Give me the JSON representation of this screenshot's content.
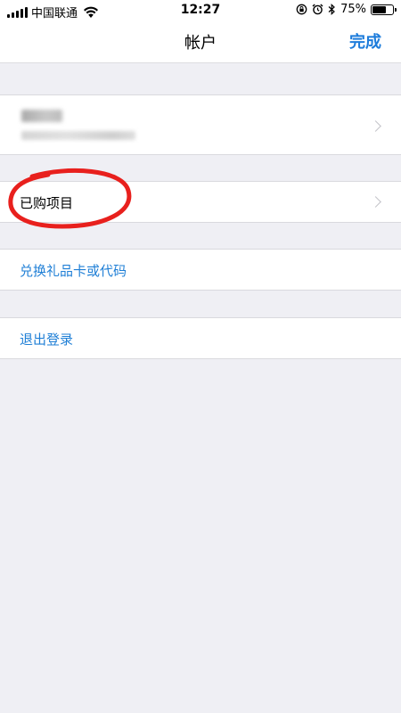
{
  "status_bar": {
    "carrier": "中国联通",
    "time": "12:27",
    "battery_text": "75%",
    "battery_level": 0.75,
    "icons": [
      "signal-icon",
      "wifi-icon",
      "orientation-lock-icon",
      "alarm-icon",
      "bluetooth-icon",
      "battery-icon"
    ]
  },
  "nav": {
    "title": "帐户",
    "done_label": "完成"
  },
  "account": {
    "name": "",
    "email": "",
    "blurred": true
  },
  "purchased": {
    "label": "已购项目",
    "annotation_color": "#e8201d"
  },
  "redeem": {
    "label": "兑换礼品卡或代码"
  },
  "signout": {
    "label": "退出登录"
  },
  "colors": {
    "accent": "#1f7fd6",
    "background": "#efeff4",
    "annotation": "#e8201d"
  }
}
